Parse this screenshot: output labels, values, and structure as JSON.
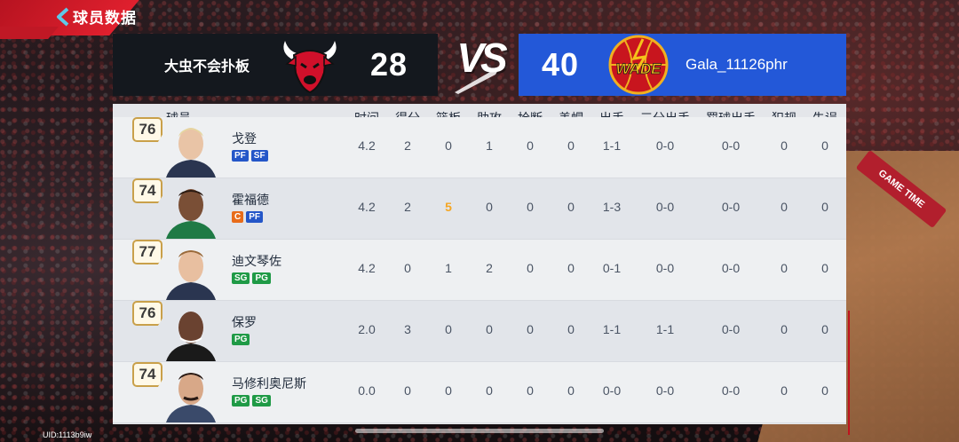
{
  "header": {
    "title": "球员数据"
  },
  "home": {
    "name": "大虫不会扑板",
    "score": "28",
    "logo_icon": "bulls-logo-icon"
  },
  "vs_text": "VS",
  "away": {
    "name": "Gala_11126phr",
    "score": "40",
    "logo_icon": "wade-logo-icon",
    "logo_text": "WADE"
  },
  "table": {
    "headers": [
      "球员",
      "时间",
      "得分",
      "篮板",
      "助攻",
      "抢断",
      "盖帽",
      "出手",
      "三分出手",
      "罚球出手",
      "犯规",
      "失误"
    ],
    "rows": [
      {
        "ovr": "76",
        "name": "戈登",
        "positions": [
          "PF",
          "SF"
        ],
        "pos_colors": [
          "blue",
          "blue"
        ],
        "min": "4.2",
        "pts": "2",
        "reb": "0",
        "ast": "1",
        "stl": "0",
        "blk": "0",
        "fg": "1-1",
        "tp": "0-0",
        "ft": "0-0",
        "pf": "0",
        "to": "0"
      },
      {
        "ovr": "74",
        "name": "霍福德",
        "positions": [
          "C",
          "PF"
        ],
        "pos_colors": [
          "orange",
          "blue"
        ],
        "min": "4.2",
        "pts": "2",
        "reb": "5",
        "ast": "0",
        "stl": "0",
        "blk": "0",
        "fg": "1-3",
        "tp": "0-0",
        "ft": "0-0",
        "pf": "0",
        "to": "0"
      },
      {
        "ovr": "77",
        "name": "迪文琴佐",
        "positions": [
          "SG",
          "PG"
        ],
        "pos_colors": [
          "green",
          "green"
        ],
        "min": "4.2",
        "pts": "0",
        "reb": "1",
        "ast": "2",
        "stl": "0",
        "blk": "0",
        "fg": "0-1",
        "tp": "0-0",
        "ft": "0-0",
        "pf": "0",
        "to": "0"
      },
      {
        "ovr": "76",
        "name": "保罗",
        "positions": [
          "PG"
        ],
        "pos_colors": [
          "green"
        ],
        "min": "2.0",
        "pts": "3",
        "reb": "0",
        "ast": "0",
        "stl": "0",
        "blk": "0",
        "fg": "1-1",
        "tp": "1-1",
        "ft": "0-0",
        "pf": "0",
        "to": "0"
      },
      {
        "ovr": "74",
        "name": "马修利奥尼斯",
        "positions": [
          "PG",
          "SG"
        ],
        "pos_colors": [
          "green",
          "green"
        ],
        "min": "0.0",
        "pts": "0",
        "reb": "0",
        "ast": "0",
        "stl": "0",
        "blk": "0",
        "fg": "0-0",
        "tp": "0-0",
        "ft": "0-0",
        "pf": "0",
        "to": "0"
      }
    ]
  },
  "footer": {
    "uid": "UID:1113b9iw"
  },
  "background": {
    "court_board": "GAME TIME"
  },
  "colors": {
    "home_bg": "#14181e",
    "away_bg": "#2358d8",
    "highlight": "#f5a623"
  }
}
